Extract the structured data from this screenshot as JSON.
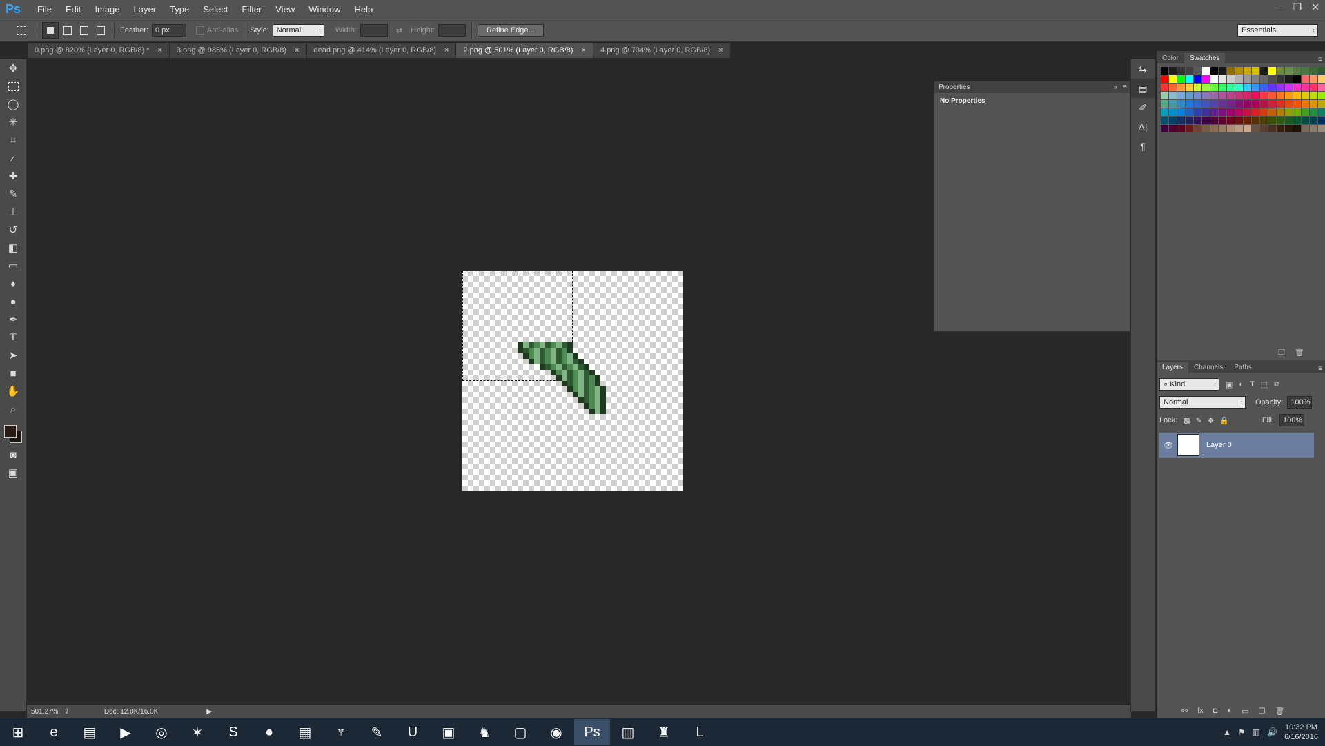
{
  "app": {
    "logo": "Ps"
  },
  "menu": [
    "File",
    "Edit",
    "Image",
    "Layer",
    "Type",
    "Select",
    "Filter",
    "View",
    "Window",
    "Help"
  ],
  "window_controls": {
    "minimize": "‒",
    "restore": "❐",
    "close": "✕"
  },
  "options": {
    "feather_label": "Feather:",
    "feather_value": "0 px",
    "antialias_label": "Anti-alias",
    "style_label": "Style:",
    "style_value": "Normal",
    "width_label": "Width:",
    "height_label": "Height:",
    "refine_label": "Refine Edge...",
    "workspace": "Essentials"
  },
  "tabs": [
    {
      "label": "0.png @ 820% (Layer 0, RGB/8) *"
    },
    {
      "label": "3.png @ 985% (Layer 0, RGB/8)"
    },
    {
      "label": "dead.png @ 414% (Layer 0, RGB/8)"
    },
    {
      "label": "2.png @ 501% (Layer 0, RGB/8)",
      "active": true
    },
    {
      "label": "4.png @ 734% (Layer 0, RGB/8)"
    }
  ],
  "tab_close": "×",
  "status": {
    "zoom": "501.27%",
    "doc": "Doc: 12.0K/16.0K"
  },
  "properties": {
    "title": "Properties",
    "content": "No Properties"
  },
  "color_panel": {
    "tab_color": "Color",
    "tab_swatches": "Swatches"
  },
  "layers_panel": {
    "tab_layers": "Layers",
    "tab_channels": "Channels",
    "tab_paths": "Paths",
    "kind": "Kind",
    "blend": "Normal",
    "opacity_label": "Opacity:",
    "opacity_value": "100%",
    "lock_label": "Lock:",
    "fill_label": "Fill:",
    "fill_value": "100%",
    "layer_name": "Layer 0"
  },
  "clock": {
    "time": "10:32 PM",
    "date": "6/16/2016"
  },
  "colors": {
    "accent": "#31a8ff",
    "panel": "#535353",
    "selected_layer": "#6b7ea0"
  },
  "swatch_colors": [
    "#000000",
    "#1f1f1f",
    "#333333",
    "#404040",
    "#595959",
    "#ffffff",
    "#000000",
    "#1a1a1a",
    "#8c6d00",
    "#b08d00",
    "#c9a800",
    "#d6c100",
    "#1a1a1a",
    "#ffff00",
    "#6e8b3d",
    "#6b8e4e",
    "#567d46",
    "#4a7a3f",
    "#3b6b35",
    "#2f5a2c",
    "#000000",
    "#ff0000",
    "#ffff00",
    "#00ff00",
    "#00ffff",
    "#0000ff",
    "#ff00ff",
    "#ffffff",
    "#e6e6e6",
    "#cccccc",
    "#b3b3b3",
    "#999999",
    "#808080",
    "#666666",
    "#4d4d4d",
    "#333333",
    "#1a1a1a",
    "#000000",
    "#ff6666",
    "#ff9966",
    "#ffcc66",
    "#ffff66",
    "#ff3333",
    "#ff6633",
    "#ff9933",
    "#ffcc33",
    "#ccff33",
    "#99ff33",
    "#66ff33",
    "#33ff66",
    "#33ff99",
    "#33ffcc",
    "#33ccff",
    "#3399ff",
    "#3366ff",
    "#6633ff",
    "#9933ff",
    "#cc33ff",
    "#ff33cc",
    "#ff3399",
    "#ff3366",
    "#ff6699",
    "#ff99cc",
    "#99ccaa",
    "#88bbcc",
    "#77aadd",
    "#6699cc",
    "#7788cc",
    "#8877bb",
    "#9966aa",
    "#aa5599",
    "#bb4488",
    "#cc3377",
    "#dd2266",
    "#ee1155",
    "#ff3344",
    "#ff5533",
    "#ff7722",
    "#ff9911",
    "#ffbb00",
    "#ddcc00",
    "#bbdd00",
    "#99ee00",
    "#77ff00",
    "#55aa88",
    "#4499aa",
    "#3388cc",
    "#2277dd",
    "#3366cc",
    "#4455bb",
    "#5544aa",
    "#663399",
    "#772288",
    "#881177",
    "#990066",
    "#aa0055",
    "#bb1144",
    "#cc2233",
    "#dd3322",
    "#ee4411",
    "#ff5500",
    "#ee7700",
    "#dd9900",
    "#bbaa00",
    "#99bb00",
    "#00a0c0",
    "#0090d0",
    "#0080e0",
    "#2060c0",
    "#3040b0",
    "#4030a0",
    "#602090",
    "#801080",
    "#a00070",
    "#c00060",
    "#d01040",
    "#e02020",
    "#d04010",
    "#c06000",
    "#b08000",
    "#90a000",
    "#70b000",
    "#40a020",
    "#209040",
    "#108060",
    "#007080",
    "#00506a",
    "#00406a",
    "#10306a",
    "#20205a",
    "#30105a",
    "#40004a",
    "#50003a",
    "#60002a",
    "#6a001a",
    "#6a100a",
    "#6a2000",
    "#5a3000",
    "#4a4000",
    "#3a5000",
    "#2a5a10",
    "#1a5a20",
    "#0a5a30",
    "#005040",
    "#004050",
    "#003060",
    "#002070",
    "#400040",
    "#500030",
    "#600020",
    "#6b1a1a",
    "#704030",
    "#7a5a40",
    "#8a6a50",
    "#9a7a60",
    "#aa8a70",
    "#ba9a80",
    "#caa890",
    "#6a5040",
    "#5a4030",
    "#4a3020",
    "#3a2010",
    "#2a1808",
    "#1a1004",
    "#7a6a5a",
    "#8a7a6a",
    "#9a8a7a",
    "#aa9a8a"
  ],
  "sprite_palette": [
    "#1d3a20",
    "#2f5a32",
    "#4f8a55",
    "#7fb584"
  ],
  "taskbar_icons": [
    {
      "name": "start-icon",
      "glyph": "⊞"
    },
    {
      "name": "ie-icon",
      "glyph": "e"
    },
    {
      "name": "explorer-icon",
      "glyph": "▤"
    },
    {
      "name": "media-icon",
      "glyph": "▶"
    },
    {
      "name": "chrome-icon",
      "glyph": "◎"
    },
    {
      "name": "app-red-icon",
      "glyph": "✶"
    },
    {
      "name": "skype-icon",
      "glyph": "S"
    },
    {
      "name": "orange-app-icon",
      "glyph": "●"
    },
    {
      "name": "notepad-icon",
      "glyph": "▦"
    },
    {
      "name": "steam-like-icon",
      "glyph": "♆"
    },
    {
      "name": "paint-icon",
      "glyph": "✎"
    },
    {
      "name": "unity-icon",
      "glyph": "U"
    },
    {
      "name": "network-icon",
      "glyph": "▣"
    },
    {
      "name": "squirrel-icon",
      "glyph": "♞"
    },
    {
      "name": "window-app-icon",
      "glyph": "▢"
    },
    {
      "name": "red-circle-app-icon",
      "glyph": "◉"
    },
    {
      "name": "photoshop-icon",
      "glyph": "Ps",
      "active": true
    },
    {
      "name": "winrar-icon",
      "glyph": "▥"
    },
    {
      "name": "game-char-icon",
      "glyph": "♜"
    },
    {
      "name": "league-icon",
      "glyph": "L"
    }
  ]
}
